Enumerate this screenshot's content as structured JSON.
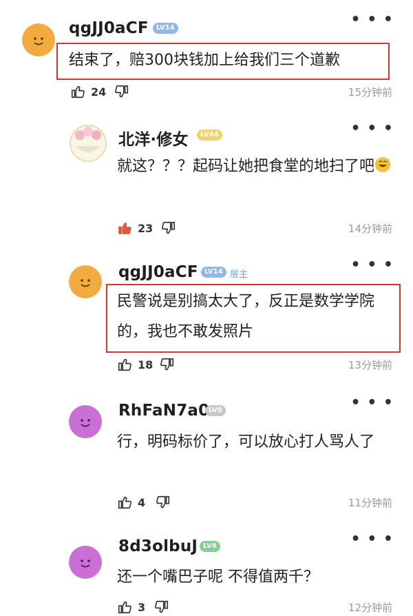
{
  "comments": [
    {
      "username": "qgJJ0aCF",
      "level": "LV14",
      "text": "结束了，赔300块钱加上给我们三个道歉",
      "likes": "24",
      "time": "15分钟前"
    },
    {
      "username": "北洋·修女",
      "level": "LV44",
      "text": "就这？？？起码让她把食堂的地扫了吧",
      "likes": "23",
      "time": "14分钟前",
      "emoji": "sweat-smile-emoji"
    },
    {
      "username": "qgJJ0aCF",
      "level": "LV14",
      "op_tag": "层主",
      "text": "民警说是别搞太大了，反正是数学学院的，我也不敢发照片",
      "likes": "18",
      "time": "13分钟前"
    },
    {
      "username": "RhFaN7a0",
      "level": "LV0",
      "text": "行，明码标价了，可以放心打人骂人了",
      "likes": "4",
      "time": "11分钟前"
    },
    {
      "username": "8d3olbuJ",
      "level": "LV8",
      "text": "还一个嘴巴子呢 不得值两千？",
      "likes": "3",
      "time": "12分钟前"
    }
  ],
  "icons": {
    "more": "more-dots-icon",
    "like": "thumbs-up-icon",
    "dislike": "thumbs-down-icon"
  },
  "colors": {
    "highlight_border": "#dd3333",
    "liked_icon": "#e0583c"
  }
}
